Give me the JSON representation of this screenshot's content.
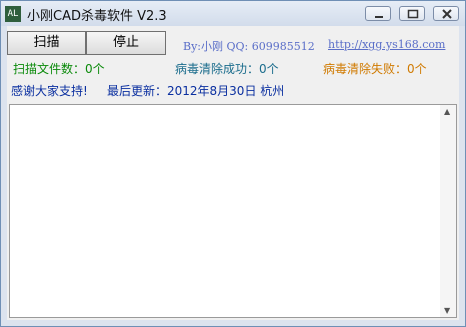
{
  "window": {
    "title": "小刚CAD杀毒软件 V2.3",
    "icon_text": "AL"
  },
  "toolbar": {
    "scan_label": "扫描",
    "stop_label": "停止"
  },
  "author": {
    "by_text": "By:小刚 QQ: 609985512",
    "url": "http://xgg.ys168.com"
  },
  "stats": {
    "scanned": "扫描文件数：0个",
    "cleaned": "病毒清除成功：0个",
    "failed": "病毒清除失败：0个"
  },
  "info": {
    "thanks": "感谢大家支持!",
    "last_update": "最后更新：2012年8月30日  杭州"
  },
  "log": {
    "text": ""
  },
  "colors": {
    "accent": "#5a6ec8",
    "success": "#0a8a0a",
    "fail": "#d07a00"
  }
}
